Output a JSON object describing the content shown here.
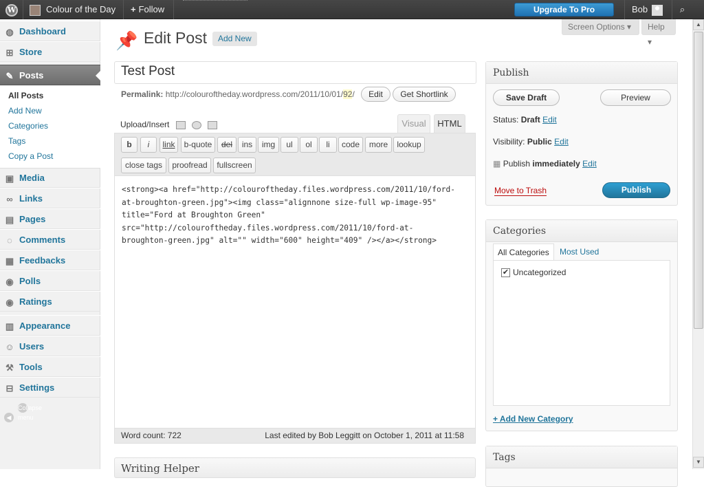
{
  "adminbar": {
    "logo_glyph": "W",
    "site_name": "Colour of the Day",
    "follow_label": "Follow",
    "upgrade_label": "Upgrade To Pro",
    "user_name": "Bob"
  },
  "sidebar": {
    "items": [
      {
        "label": "Dashboard",
        "icon": "dashboard-icon",
        "glyph": "◍"
      },
      {
        "label": "Store",
        "icon": "cart-icon",
        "glyph": "⊞"
      },
      {
        "label": "Posts",
        "icon": "pin-icon",
        "glyph": "✎"
      },
      {
        "label": "Media",
        "icon": "media-icon",
        "glyph": "▣"
      },
      {
        "label": "Links",
        "icon": "link-icon",
        "glyph": "∞"
      },
      {
        "label": "Pages",
        "icon": "pages-icon",
        "glyph": "▤"
      },
      {
        "label": "Comments",
        "icon": "comment-icon",
        "glyph": "◌"
      },
      {
        "label": "Feedbacks",
        "icon": "feedback-icon",
        "glyph": "▦"
      },
      {
        "label": "Polls",
        "icon": "polls-icon",
        "glyph": "◉"
      },
      {
        "label": "Ratings",
        "icon": "ratings-icon",
        "glyph": "◉"
      },
      {
        "label": "Appearance",
        "icon": "appearance-icon",
        "glyph": "▥"
      },
      {
        "label": "Users",
        "icon": "users-icon",
        "glyph": "☺"
      },
      {
        "label": "Tools",
        "icon": "tools-icon",
        "glyph": "⚒"
      },
      {
        "label": "Settings",
        "icon": "settings-icon",
        "glyph": "⊟"
      }
    ],
    "submenu": [
      "All Posts",
      "Add New",
      "Categories",
      "Tags",
      "Copy a Post"
    ],
    "collapse_label": "Collapse menu"
  },
  "screen_options": {
    "screen_label": "Screen Options ▾",
    "help_label": "Help ▾"
  },
  "page": {
    "title": "Edit Post",
    "add_new": "Add New"
  },
  "post": {
    "title": "Test Post",
    "permalink_label": "Permalink:",
    "permalink_base": "http://colouroftheday.wordpress.com/2011/10/01/",
    "permalink_slug": "92",
    "permalink_end": "/",
    "edit_btn": "Edit",
    "shortlink_btn": "Get Shortlink"
  },
  "editor": {
    "upload_label": "Upload/Insert",
    "tab_visual": "Visual",
    "tab_html": "HTML",
    "quicktags_row1": [
      "b",
      "i",
      "link",
      "b-quote",
      "del",
      "ins",
      "img",
      "ul",
      "ol",
      "li",
      "code",
      "more",
      "lookup"
    ],
    "quicktags_row2": [
      "close tags",
      "proofread",
      "fullscreen"
    ],
    "content": "<strong><a href=\"http://colouroftheday.files.wordpress.com/2011/10/ford-\nat-broughton-green.jpg\"><img class=\"alignnone size-full wp-image-95\"\ntitle=\"Ford at Broughton Green\"\nsrc=\"http://colouroftheday.files.wordpress.com/2011/10/ford-at-\nbroughton-green.jpg\" alt=\"\" width=\"600\" height=\"409\" /></a></strong>",
    "word_count": "Word count: 722",
    "last_edited": "Last edited by Bob Leggitt on October 1, 2011 at 11:58"
  },
  "writing_helper": {
    "title": "Writing Helper"
  },
  "publish": {
    "title": "Publish",
    "save_draft": "Save Draft",
    "preview": "Preview",
    "status_label": "Status:",
    "status_value": "Draft",
    "visibility_label": "Visibility:",
    "visibility_value": "Public",
    "schedule_label": "Publish",
    "schedule_value": "immediately",
    "edit_link": "Edit",
    "trash": "Move to Trash",
    "publish_btn": "Publish"
  },
  "categories": {
    "title": "Categories",
    "tab_all": "All Categories",
    "tab_most": "Most Used",
    "items": [
      {
        "label": "Uncategorized",
        "checked": true
      }
    ],
    "add_new": "+ Add New Category"
  },
  "tags": {
    "title": "Tags"
  }
}
